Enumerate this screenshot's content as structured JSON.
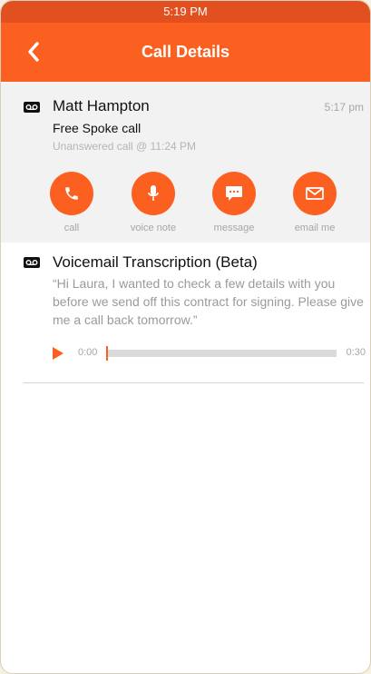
{
  "status_bar": {
    "time": "5:19 PM"
  },
  "nav": {
    "title": "Call Details",
    "back_icon": "chevron-left-icon"
  },
  "call": {
    "caller_name": "Matt Hampton",
    "time": "5:17 pm",
    "type": "Free Spoke call",
    "subtitle": "Unanswered call @ 11:24 PM",
    "icon": "voicemail-icon"
  },
  "actions": [
    {
      "label": "call",
      "icon": "phone-icon"
    },
    {
      "label": "voice note",
      "icon": "microphone-icon"
    },
    {
      "label": "message",
      "icon": "message-icon"
    },
    {
      "label": "email me",
      "icon": "envelope-icon"
    }
  ],
  "voicemail": {
    "title": "Voicemail Transcription (Beta)",
    "transcript": "“Hi Laura, I wanted to check a few details with you before we send off this contract for signing. Please give me a call back tomorrow.”",
    "icon": "voicemail-icon",
    "player": {
      "current_time": "0:00",
      "duration": "0:30",
      "progress": 0
    }
  },
  "colors": {
    "accent": "#fc6020",
    "status_bar": "#e2501f",
    "section_bg": "#f2f2f2",
    "muted_text": "#a6a6a6"
  }
}
